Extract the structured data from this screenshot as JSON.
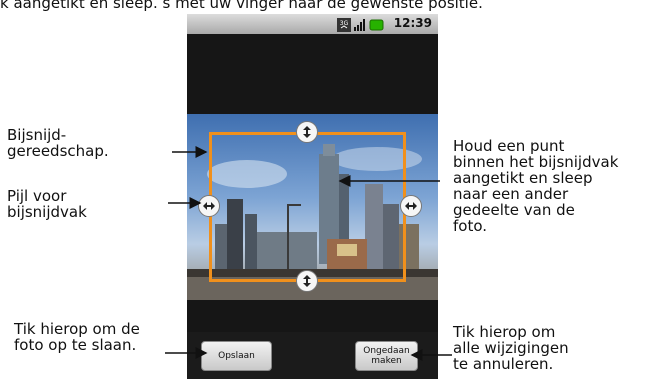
{
  "page": {
    "top_caption": "k aangetikt en sleep. s met uw vinger naar de gewenste positie."
  },
  "phone": {
    "status_time": "12:39",
    "icons": [
      "3g-icon",
      "signal-icon",
      "battery-icon"
    ],
    "save_button": "Opslaan",
    "undo_button": "Ongedaan\nmaken"
  },
  "callouts": {
    "crop_tool": "Bijsnijd-\ngereedschap.",
    "crop_arrow": "Pijl voor\nbijsnijdvak",
    "drag_hint": "Houd een punt\nbinnen het bijsnijdvak\naangetikt en sleep\nnaar een ander\ngedeelte van de\nfoto.",
    "save_hint": "Tik hierop om de\nfoto op te slaan.",
    "undo_hint": "Tik hierop om\nalle wijzigingen\nte annuleren."
  },
  "colors": {
    "crop_border": "#f0901c",
    "background": "#ffffff"
  }
}
